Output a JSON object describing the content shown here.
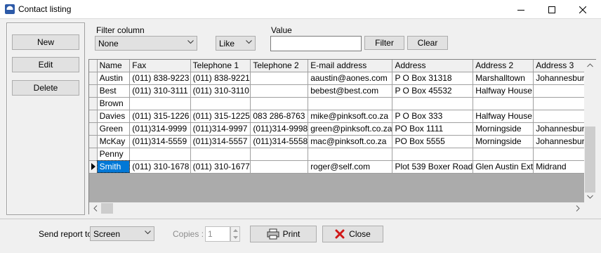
{
  "window": {
    "title": "Contact listing",
    "icon": "app-window-icon"
  },
  "actions": {
    "new": "New",
    "edit": "Edit",
    "delete": "Delete"
  },
  "filter": {
    "column_label": "Filter column",
    "column_value": "None",
    "operator_value": "Like",
    "value_label": "Value",
    "value_text": "",
    "filter_button": "Filter",
    "clear_button": "Clear"
  },
  "grid": {
    "columns": [
      "Name",
      "Fax",
      "Telephone 1",
      "Telephone 2",
      "E-mail address",
      "Address",
      "Address 2",
      "Address 3"
    ],
    "rows": [
      [
        "Austin",
        "(011) 838-9223",
        "(011) 838-9221",
        "",
        "aaustin@aones.com",
        "P O Box 31318",
        "Marshalltown",
        "Johannesburg"
      ],
      [
        "Best",
        "(011) 310-3111",
        "(011) 310-3110",
        "",
        "bebest@best.com",
        "P O Box 45532",
        "Halfway House",
        ""
      ],
      [
        "Brown",
        "",
        "",
        "",
        "",
        "",
        "",
        ""
      ],
      [
        "Davies",
        "(011) 315-1226",
        "(011) 315-1225",
        "083 286-8763",
        "mike@pinksoft.co.za",
        "P O Box 333",
        "Halfway House",
        ""
      ],
      [
        "Green",
        "(011)314-9999",
        "(011)314-9997",
        "(011)314-9998",
        "green@pinksoft.co.za",
        "PO Box 1111",
        "Morningside",
        "Johannesburg"
      ],
      [
        "McKay",
        "(011)314-5559",
        "(011)314-5557",
        "(011)314-5558",
        "mac@pinksoft.co.za",
        "PO Box 5555",
        "Morningside",
        "Johannesburg"
      ],
      [
        "Penny",
        "",
        "",
        "",
        "",
        "",
        "",
        ""
      ],
      [
        "Smith",
        "(011) 310-1678",
        "(011) 310-1677",
        "",
        "roger@self.com",
        "Plot 539 Boxer Road",
        "Glen Austin Ext",
        "Midrand"
      ]
    ],
    "selected_row": 7
  },
  "footer": {
    "send_label": "Send report to:",
    "send_value": "Screen",
    "copies_label": "Copies :",
    "copies_value": "1",
    "print_button": "Print",
    "close_button": "Close"
  }
}
